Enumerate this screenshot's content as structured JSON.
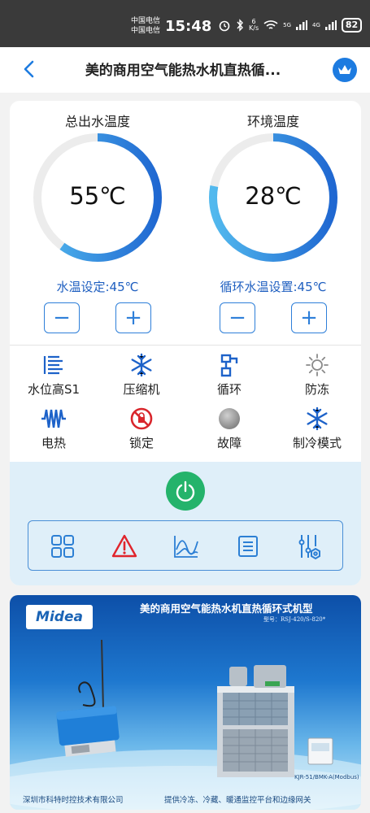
{
  "status_bar": {
    "carrier_1": "中国电信",
    "carrier_2": "中国电信",
    "time": "15:48",
    "speed_value": "6",
    "speed_unit": "K/s",
    "battery": "82",
    "net1": "5G",
    "net2": "4G"
  },
  "header": {
    "title": "美的商用空气能热水机直热循...",
    "back_icon": "chevron-left-icon",
    "crown_icon": "crown-icon"
  },
  "gauges": [
    {
      "label": "总出水温度",
      "value": "55℃",
      "setting": "水温设定:45℃",
      "fill_fraction": 0.6
    },
    {
      "label": "环境温度",
      "value": "28℃",
      "setting": "循环水温设置:45℃",
      "fill_fraction": 0.78
    }
  ],
  "stepper": {
    "minus": "−",
    "plus": "+"
  },
  "status_items": [
    {
      "label": "水位高S1",
      "icon": "heater-coil-icon",
      "color": "#1d62c9"
    },
    {
      "label": "压缩机",
      "icon": "snowflake-icon",
      "color": "#1d62c9"
    },
    {
      "label": "循环",
      "icon": "pump-icon",
      "color": "#1d62c9"
    },
    {
      "label": "防冻",
      "icon": "sun-icon",
      "color": "#8a8a8a"
    },
    {
      "label": "电热",
      "icon": "electric-heat-icon",
      "color": "#1d62c9"
    },
    {
      "label": "锁定",
      "icon": "lock-prohibited-icon",
      "color": "#d9262c"
    },
    {
      "label": "故障",
      "icon": "fault-dot-icon",
      "color": "#9a9a9a"
    },
    {
      "label": "制冷模式",
      "icon": "snowflake-icon",
      "color": "#1d62c9"
    }
  ],
  "controls": {
    "power_icon": "power-icon",
    "toolbar": [
      "grid-icon",
      "warning-icon",
      "chart-icon",
      "list-icon",
      "settings-sliders-icon"
    ]
  },
  "banner": {
    "brand": "Midea",
    "title": "美的商用空气能热水机直热循环式机型",
    "model": "型号：RSJ-420/S-820*",
    "controller_label": "KJR-51/BMK-A(Modbus)",
    "footer_left": "深圳市科特时控技术有限公司",
    "footer_right": "提供冷冻、冷藏、暖通监控平台和边缘网关"
  },
  "colors": {
    "accent": "#1d7be0",
    "gauge_track": "#ececec",
    "power_green": "#24b36b",
    "control_bg": "#dfeff9"
  }
}
